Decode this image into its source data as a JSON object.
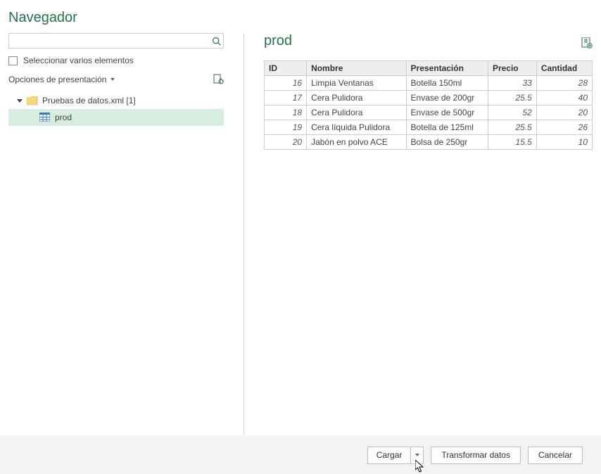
{
  "title": "Navegador",
  "search": {
    "value": ""
  },
  "multiselect": {
    "label": "Seleccionar varios elementos",
    "checked": false
  },
  "options_label": "Opciones de presentación",
  "tree": {
    "root": {
      "label": "Pruebas de datos.xml [1]"
    },
    "child": {
      "label": "prod"
    }
  },
  "preview": {
    "title": "prod",
    "columns": [
      "ID",
      "Nombre",
      "Presentación",
      "Precio",
      "Cantidad"
    ],
    "rows": [
      {
        "id": 16,
        "nombre": "Limpia Ventanas",
        "presentacion": "Botella 150ml",
        "precio": 33,
        "cantidad": 28
      },
      {
        "id": 17,
        "nombre": "Cera Pulidora",
        "presentacion": "Envase de 200gr",
        "precio": 25.5,
        "cantidad": 40
      },
      {
        "id": 18,
        "nombre": "Cera Pulidora",
        "presentacion": "Envase de 500gr",
        "precio": 52,
        "cantidad": 20
      },
      {
        "id": 19,
        "nombre": "Cera líquida Pulidora",
        "presentacion": "Botella de 125ml",
        "precio": 25.5,
        "cantidad": 26
      },
      {
        "id": 20,
        "nombre": "Jabón en polvo ACE",
        "presentacion": "Bolsa de 250gr",
        "precio": 15.5,
        "cantidad": 10
      }
    ]
  },
  "buttons": {
    "load": "Cargar",
    "transform": "Transformar datos",
    "cancel": "Cancelar"
  }
}
